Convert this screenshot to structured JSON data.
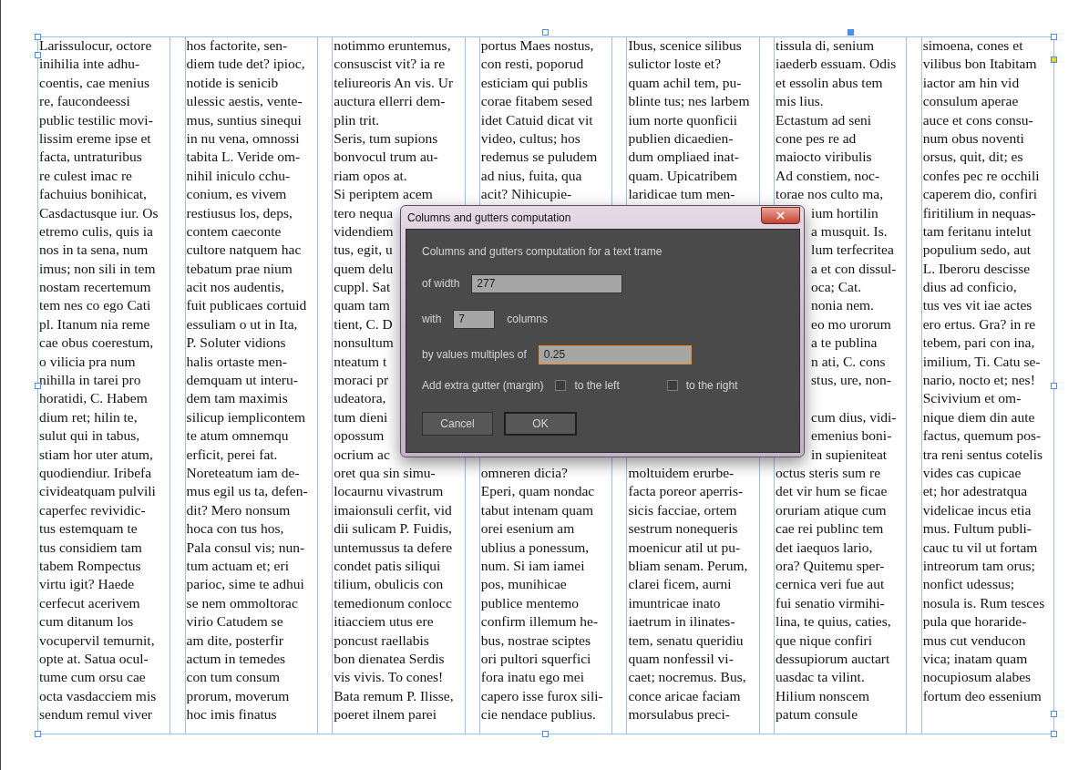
{
  "document": {
    "columns": [
      {
        "rows": [
          {
            "kind": "line",
            "text": "Larissulocur, octore"
          },
          {
            "kind": "line",
            "text": "inihilia inte adhu-"
          },
          {
            "kind": "line",
            "text": "coentis, cae menius"
          },
          {
            "kind": "line",
            "text": "re, faucondeessi"
          },
          {
            "kind": "line",
            "text": "public testilic movi-"
          },
          {
            "kind": "line",
            "text": "lissim ereme ipse et"
          },
          {
            "kind": "line",
            "text": "facta, untraturibus"
          },
          {
            "kind": "line",
            "text": "re culest imac re"
          },
          {
            "kind": "line",
            "text": "fachuius bonihicat,"
          },
          {
            "kind": "line",
            "text": "Casdactusque iur. Os"
          },
          {
            "kind": "line",
            "text": "etremo culis, quis ia"
          },
          {
            "kind": "line",
            "text": "nos in ta sena, num"
          },
          {
            "kind": "line",
            "text": "imus; non sili in tem"
          },
          {
            "kind": "line",
            "text": "nostam recertemum"
          },
          {
            "kind": "line",
            "text": "tem nes co ego Cati"
          },
          {
            "kind": "line",
            "text": "pl. Itanum nia reme"
          },
          {
            "kind": "line",
            "text": "cae obus coerestum,"
          },
          {
            "kind": "line",
            "text": "o vilicia pra num"
          },
          {
            "kind": "line",
            "text": "nihilla in tarei pro"
          },
          {
            "kind": "line",
            "text": "horatidi, C. Habem"
          },
          {
            "kind": "line",
            "text": "dium ret; hilin te,"
          },
          {
            "kind": "line",
            "text": "sulut qui in tabus,"
          },
          {
            "kind": "line",
            "text": "stiam hor uter atum,"
          },
          {
            "kind": "line",
            "text": "quodiendiur. Iribefa"
          },
          {
            "kind": "line",
            "text": "civideatquam pulvili"
          },
          {
            "kind": "line",
            "text": "caperfec revividic-"
          },
          {
            "kind": "line",
            "text": "tus estemquam te"
          },
          {
            "kind": "line",
            "text": "tus considiem tam"
          },
          {
            "kind": "line",
            "text": "tabem Rompectus"
          },
          {
            "kind": "line",
            "text": "virtu igit? Haede"
          },
          {
            "kind": "line",
            "text": "cerfecut acerivem"
          },
          {
            "kind": "line",
            "text": "cum ditanum los"
          },
          {
            "kind": "line",
            "text": "vocupervil temurnit,"
          },
          {
            "kind": "line",
            "text": "opte at. Satua ocul-"
          },
          {
            "kind": "line",
            "text": "tume cum orsu cae"
          },
          {
            "kind": "line",
            "text": "octa vasdacciem mis"
          },
          {
            "kind": "line",
            "text": "sendum remul viver"
          }
        ]
      },
      {
        "rows": [
          {
            "kind": "line",
            "text": "hos factorite, sen-"
          },
          {
            "kind": "line",
            "text": "diem tude det? ipioc,"
          },
          {
            "kind": "line",
            "text": "notide is senicib"
          },
          {
            "kind": "line",
            "text": "ulessic aestis, vente-"
          },
          {
            "kind": "line",
            "text": "mus, suntius sinequi"
          },
          {
            "kind": "line",
            "text": "in nu vena, omnossi"
          },
          {
            "kind": "line",
            "text": "tabita L. Veride om-"
          },
          {
            "kind": "line",
            "text": "nihil iniculo cchu-"
          },
          {
            "kind": "line",
            "text": "conium, es vivem"
          },
          {
            "kind": "line",
            "text": "restiusus los, deps,"
          },
          {
            "kind": "line",
            "text": "contem caeconte"
          },
          {
            "kind": "line",
            "text": "cultore natquem hac"
          },
          {
            "kind": "line",
            "text": "tebatum prae nium"
          },
          {
            "kind": "line",
            "text": "acit nos audentis,"
          },
          {
            "kind": "line",
            "text": "fuit publicaes cortuid"
          },
          {
            "kind": "line",
            "text": "essuliam o ut in Ita,"
          },
          {
            "kind": "line",
            "text": "P. Soluter vidions"
          },
          {
            "kind": "line",
            "text": "halis ortaste men-"
          },
          {
            "kind": "line",
            "text": "demquam ut interu-"
          },
          {
            "kind": "line",
            "text": "dem tam maximis"
          },
          {
            "kind": "line",
            "text": "silicup iemplicontem"
          },
          {
            "kind": "line",
            "text": "te atum omnemqu"
          },
          {
            "kind": "line",
            "text": "erficit, perei fat."
          },
          {
            "kind": "line",
            "text": "Noreteatum iam de-"
          },
          {
            "kind": "line",
            "text": "mus egil us ta, defen-"
          },
          {
            "kind": "line",
            "text": "dit? Mero nonsum"
          },
          {
            "kind": "line",
            "text": "hoca con tus hos,"
          },
          {
            "kind": "line",
            "text": "Pala consul vis; nun-"
          },
          {
            "kind": "line",
            "text": "tum actuam et; eri"
          },
          {
            "kind": "line",
            "text": "parioc, sime te adhui"
          },
          {
            "kind": "line",
            "text": "se nem ommoltorac"
          },
          {
            "kind": "line",
            "text": "virio Catudem se"
          },
          {
            "kind": "line",
            "text": "am dite, posterfir"
          },
          {
            "kind": "line",
            "text": "actum in temedes"
          },
          {
            "kind": "line",
            "text": "con tum consum"
          },
          {
            "kind": "line",
            "text": "prorum, moverum"
          },
          {
            "kind": "line",
            "text": "hoc imis finatus"
          }
        ]
      },
      {
        "rows": [
          {
            "kind": "line",
            "text": "notimmo eruntemus,"
          },
          {
            "kind": "line",
            "text": "consuscist vit? ia re"
          },
          {
            "kind": "line",
            "text": "teliureoris An vis. Ur"
          },
          {
            "kind": "line",
            "text": "auctura ellerri dem-"
          },
          {
            "kind": "line",
            "text": "plin trit."
          },
          {
            "kind": "line",
            "text": "Seris, tum supions"
          },
          {
            "kind": "line",
            "text": "bonvocul trum au-"
          },
          {
            "kind": "line",
            "text": "riam opos at."
          },
          {
            "kind": "line",
            "text": "Si periptem acem"
          },
          {
            "kind": "line",
            "text": "tero nequa"
          },
          {
            "kind": "line",
            "text": "videndiem"
          },
          {
            "kind": "line",
            "text": "tus, egit, u"
          },
          {
            "kind": "line",
            "text": "quem delu"
          },
          {
            "kind": "line",
            "text": "cuppl. Sat"
          },
          {
            "kind": "line",
            "text": "quam tam"
          },
          {
            "kind": "line",
            "text": "tient, C. D"
          },
          {
            "kind": "line",
            "text": "nonsultum"
          },
          {
            "kind": "line",
            "text": "nteatum t"
          },
          {
            "kind": "line",
            "text": "moraci pr"
          },
          {
            "kind": "line",
            "text": "udeatora,"
          },
          {
            "kind": "line",
            "text": "tum dieni"
          },
          {
            "kind": "line",
            "text": "opossum"
          },
          {
            "kind": "line",
            "text": "ocrium ac"
          },
          {
            "kind": "line",
            "text": "oret qua sin simu-"
          },
          {
            "kind": "line",
            "text": "locaurnu vivastrum"
          },
          {
            "kind": "line",
            "text": "imaionsuli cerfit, vid"
          },
          {
            "kind": "line",
            "text": "dii sulicam P. Fuidis,"
          },
          {
            "kind": "line",
            "text": "untemussus ta defere"
          },
          {
            "kind": "line",
            "text": "condet patis siliqui"
          },
          {
            "kind": "line",
            "text": "tilium, obulicis con"
          },
          {
            "kind": "line",
            "text": "temedionum conlocc"
          },
          {
            "kind": "line",
            "text": "itiacciem utus ere"
          },
          {
            "kind": "line",
            "text": "poncust raellabis"
          },
          {
            "kind": "line",
            "text": "bon dienatea Serdis"
          },
          {
            "kind": "line",
            "text": "vis vivis. To cones!"
          },
          {
            "kind": "line",
            "text": "Bata remum P. Ilisse,"
          },
          {
            "kind": "line",
            "text": "poeret ilnem parei"
          }
        ]
      },
      {
        "rows": [
          {
            "kind": "line",
            "text": "portus Maes nostus,"
          },
          {
            "kind": "line",
            "text": "con resti, poporud"
          },
          {
            "kind": "line",
            "text": "esticiam qui publis"
          },
          {
            "kind": "line",
            "text": "corae fitabem sesed"
          },
          {
            "kind": "line",
            "text": "idet Catuid dicat vit"
          },
          {
            "kind": "line",
            "text": "video, cultus; hos"
          },
          {
            "kind": "line",
            "text": "redemus se puludem"
          },
          {
            "kind": "line",
            "text": "ad nius, fuita, qua"
          },
          {
            "kind": "line",
            "text": "acit? Nihicupie-"
          },
          {
            "kind": "hidden"
          },
          {
            "kind": "hidden"
          },
          {
            "kind": "hidden"
          },
          {
            "kind": "hidden"
          },
          {
            "kind": "hidden"
          },
          {
            "kind": "hidden"
          },
          {
            "kind": "hidden"
          },
          {
            "kind": "hidden"
          },
          {
            "kind": "hidden"
          },
          {
            "kind": "hidden"
          },
          {
            "kind": "hidden"
          },
          {
            "kind": "hidden"
          },
          {
            "kind": "hidden"
          },
          {
            "kind": "hidden"
          },
          {
            "kind": "line",
            "text": "omneren dicia?"
          },
          {
            "kind": "line",
            "text": "Eperi, quam nondac"
          },
          {
            "kind": "line",
            "text": "tabut intenam quam"
          },
          {
            "kind": "line",
            "text": "orei esenium am"
          },
          {
            "kind": "line",
            "text": "ublius a ponessum,"
          },
          {
            "kind": "line",
            "text": "num. Si iam iamei"
          },
          {
            "kind": "line",
            "text": "pos, munihicae"
          },
          {
            "kind": "line",
            "text": "publice mentemo"
          },
          {
            "kind": "line",
            "text": "confirm illemum he-"
          },
          {
            "kind": "line",
            "text": "bus, nostrae sciptes"
          },
          {
            "kind": "line",
            "text": "ori pultori squerfici"
          },
          {
            "kind": "line",
            "text": "fora inatu ego mei"
          },
          {
            "kind": "line",
            "text": "capero isse furox sili-"
          },
          {
            "kind": "line",
            "text": "cie nendace publius."
          }
        ]
      },
      {
        "rows": [
          {
            "kind": "line",
            "text": "Ibus, scenice silibus"
          },
          {
            "kind": "line",
            "text": "sulictor loste et?"
          },
          {
            "kind": "line",
            "text": "quam achil tem, pu-"
          },
          {
            "kind": "line",
            "text": "blinte tus; nes larbem"
          },
          {
            "kind": "line",
            "text": "ium norte quonficii"
          },
          {
            "kind": "line",
            "text": "publien dicaedien-"
          },
          {
            "kind": "line",
            "text": "dum ompliaed inat-"
          },
          {
            "kind": "line",
            "text": "quam. Upicatribem"
          },
          {
            "kind": "line",
            "text": "laridicae tum men-"
          },
          {
            "kind": "hidden"
          },
          {
            "kind": "hidden"
          },
          {
            "kind": "hidden"
          },
          {
            "kind": "hidden"
          },
          {
            "kind": "hidden"
          },
          {
            "kind": "hidden"
          },
          {
            "kind": "hidden"
          },
          {
            "kind": "hidden"
          },
          {
            "kind": "hidden"
          },
          {
            "kind": "hidden"
          },
          {
            "kind": "hidden"
          },
          {
            "kind": "hidden"
          },
          {
            "kind": "hidden"
          },
          {
            "kind": "hidden"
          },
          {
            "kind": "line",
            "text": "moltuidem erurbe-"
          },
          {
            "kind": "line",
            "text": "facta poreor aperris-"
          },
          {
            "kind": "line",
            "text": "sicis facciae, ortem"
          },
          {
            "kind": "line",
            "text": "sestrum nonequeris"
          },
          {
            "kind": "line",
            "text": "moenicur atil ut pu-"
          },
          {
            "kind": "line",
            "text": "bliam senam. Perum,"
          },
          {
            "kind": "line",
            "text": "clarei ficem, aurni"
          },
          {
            "kind": "line",
            "text": "imuntricae inato"
          },
          {
            "kind": "line",
            "text": "iaetrum in ilinates-"
          },
          {
            "kind": "line",
            "text": "tem, senatu queridiu"
          },
          {
            "kind": "line",
            "text": "quam nonfessil vi-"
          },
          {
            "kind": "line",
            "text": "caet; nocremus. Bus,"
          },
          {
            "kind": "line",
            "text": "conce aricae faciam"
          },
          {
            "kind": "line",
            "text": "morsulabus preci-"
          }
        ]
      },
      {
        "rows": [
          {
            "kind": "line",
            "text": "tissula di, senium"
          },
          {
            "kind": "line",
            "text": "iaederb essuam. Odis"
          },
          {
            "kind": "line",
            "text": "et essolin abus tem"
          },
          {
            "kind": "line",
            "text": "mis lius."
          },
          {
            "kind": "line",
            "text": "Ectastum ad seni"
          },
          {
            "kind": "line",
            "text": "cone pes re ad"
          },
          {
            "kind": "line",
            "text": "maiocto viribulis"
          },
          {
            "kind": "line",
            "text": "Ad constiem, noc-"
          },
          {
            "kind": "line",
            "text": "torae nos culto ma,"
          },
          {
            "kind": "cut_left",
            "text": "ium hortilin"
          },
          {
            "kind": "cut_left",
            "text": "a musquit. Is."
          },
          {
            "kind": "cut_left",
            "text": "lum terfecritea"
          },
          {
            "kind": "cut_left",
            "text": "a et con dissul-"
          },
          {
            "kind": "cut_left",
            "text": "oca; Cat."
          },
          {
            "kind": "cut_left",
            "text": "nonia nem."
          },
          {
            "kind": "cut_left",
            "text": "eo mo urorum"
          },
          {
            "kind": "cut_left",
            "text": "a te publina"
          },
          {
            "kind": "cut_left",
            "text": "n ati, C. cons"
          },
          {
            "kind": "cut_left",
            "text": "stus, ure, non-"
          },
          {
            "kind": "hidden"
          },
          {
            "kind": "cut_left",
            "text": "cum dius, vidi-"
          },
          {
            "kind": "cut_left",
            "text": "emenius boni-"
          },
          {
            "kind": "cut_left",
            "text": "in supieniteat"
          },
          {
            "kind": "line",
            "text": "octus steris sum re"
          },
          {
            "kind": "line",
            "text": "det vir hum se ficae"
          },
          {
            "kind": "line",
            "text": "oruriam atique cum"
          },
          {
            "kind": "line",
            "text": "cae rei publinc tem"
          },
          {
            "kind": "line",
            "text": "det iaequos lario,"
          },
          {
            "kind": "line",
            "text": "ora? Quitemu sper-"
          },
          {
            "kind": "line",
            "text": "cernica veri fue aut"
          },
          {
            "kind": "line",
            "text": "fui senatio virmihi-"
          },
          {
            "kind": "line",
            "text": "lina, te quius, caties,"
          },
          {
            "kind": "line",
            "text": "que nique confiri"
          },
          {
            "kind": "line",
            "text": "dessupiorum auctart"
          },
          {
            "kind": "line",
            "text": "uasdac ta vilint."
          },
          {
            "kind": "line",
            "text": "Hilium nonscem"
          },
          {
            "kind": "line",
            "text": "patum consule"
          }
        ]
      },
      {
        "rows": [
          {
            "kind": "line",
            "text": "simoena, cones et"
          },
          {
            "kind": "line",
            "text": "vilibus bon Itabitam"
          },
          {
            "kind": "line",
            "text": "iactor am hin vid"
          },
          {
            "kind": "line",
            "text": "consulum aperae"
          },
          {
            "kind": "line",
            "text": "auce et cons consu-"
          },
          {
            "kind": "line",
            "text": "num obus noventi"
          },
          {
            "kind": "line",
            "text": "orsus, quit, dit; es"
          },
          {
            "kind": "line",
            "text": "confes pec re occhili"
          },
          {
            "kind": "line",
            "text": "caperem dio, confiri"
          },
          {
            "kind": "line",
            "text": "firitilium in nequas-"
          },
          {
            "kind": "line",
            "text": "tam feritanu intelut"
          },
          {
            "kind": "line",
            "text": "populium sedo, aut"
          },
          {
            "kind": "line",
            "text": "L. Iberoru descisse"
          },
          {
            "kind": "line",
            "text": "dius ad conficio,"
          },
          {
            "kind": "line",
            "text": "tus ves vit iae actes"
          },
          {
            "kind": "line",
            "text": "ero ertus. Gra? in re"
          },
          {
            "kind": "line",
            "text": "tebem, pari con ina,"
          },
          {
            "kind": "line",
            "text": "imilium, Ti. Catu se-"
          },
          {
            "kind": "line",
            "text": "nario, nocto et; nes!"
          },
          {
            "kind": "line",
            "text": "Scivivium et om-"
          },
          {
            "kind": "line",
            "text": "nique diem din aute"
          },
          {
            "kind": "line",
            "text": "factus, quemum pos-"
          },
          {
            "kind": "line",
            "text": "tra reni sentus cotelis"
          },
          {
            "kind": "line",
            "text": "vides cas cupicae"
          },
          {
            "kind": "line",
            "text": "et; hor adestratqua"
          },
          {
            "kind": "line",
            "text": "videlicae incus etia"
          },
          {
            "kind": "line",
            "text": "mus. Fultum publi-"
          },
          {
            "kind": "line",
            "text": "cauc tu vil ut fortam"
          },
          {
            "kind": "line",
            "text": "intreorum tam orus;"
          },
          {
            "kind": "line",
            "text": "nonfict udessus;"
          },
          {
            "kind": "line",
            "text": "nosula is. Rum tesces"
          },
          {
            "kind": "line",
            "text": "pula que horaride-"
          },
          {
            "kind": "line",
            "text": "mus cut venducon"
          },
          {
            "kind": "line",
            "text": "vica; inatam quam"
          },
          {
            "kind": "line",
            "text": "nocupiosum alabes"
          },
          {
            "kind": "line",
            "text": "fortum deo essenium"
          }
        ]
      }
    ]
  },
  "dialog": {
    "title": "Columns and gutters computation",
    "heading": "Columns and gutters computation for a text trame",
    "fields": [
      {
        "kind": "wide",
        "label": "of width",
        "value": "277",
        "focused": false
      },
      {
        "kind": "narrow",
        "label": "with",
        "value": "7",
        "suffix": "columns",
        "focused": false
      },
      {
        "kind": "wide",
        "label": "by values multiples of",
        "value": "0.25",
        "focused": true
      }
    ],
    "margin": {
      "label": "Add extra gutter (margin)",
      "options": [
        {
          "label": "to the left",
          "checked": false
        },
        {
          "label": "to the right",
          "checked": false
        }
      ]
    },
    "buttons": [
      {
        "label": "Cancel",
        "default": false
      },
      {
        "label": "OK",
        "default": true
      }
    ]
  }
}
